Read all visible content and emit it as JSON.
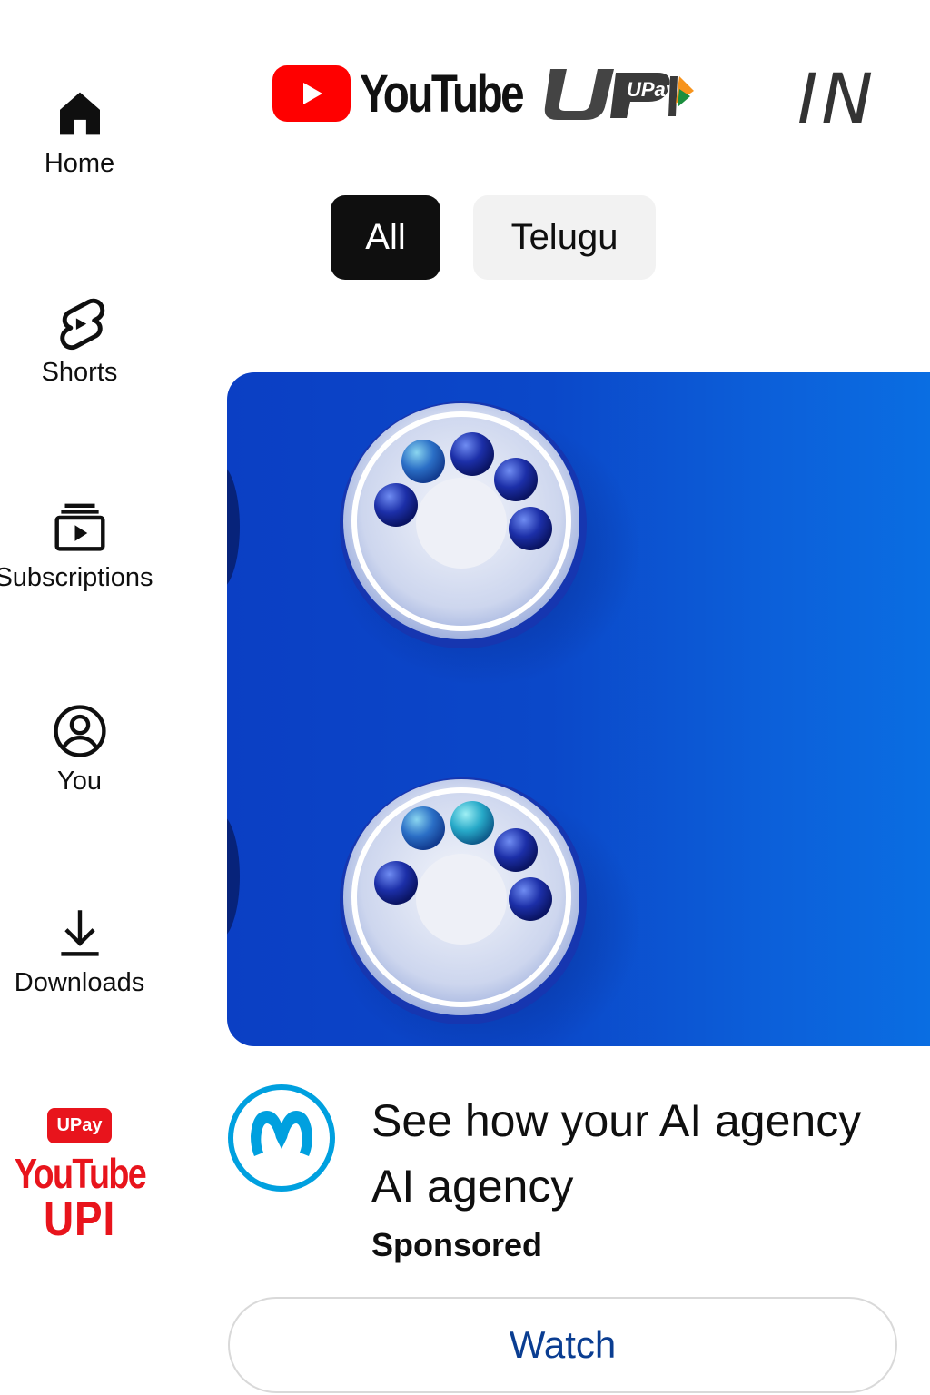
{
  "sidebar": {
    "items": [
      {
        "label": "Home",
        "icon": "home-icon"
      },
      {
        "label": "Shorts",
        "icon": "shorts-icon"
      },
      {
        "label": "Subscriptions",
        "icon": "subscriptions-icon"
      },
      {
        "label": "You",
        "icon": "account-circle-icon"
      },
      {
        "label": "Downloads",
        "icon": "download-icon"
      }
    ],
    "brand": {
      "badge": "UPay",
      "line1": "YouTube",
      "line2": "UPI"
    }
  },
  "header": {
    "logo_text": "YouTube",
    "upi_logo_text": "UPay",
    "country": "IN"
  },
  "chips": [
    {
      "label": "All",
      "selected": true
    },
    {
      "label": "Telugu",
      "selected": false
    }
  ],
  "ad": {
    "title_line1": "See how your AI agency",
    "title_line2": "AI agency",
    "sponsored": "Sponsored",
    "cta": "Watch",
    "channel_icon": "mulesoft-logo-icon"
  },
  "colors": {
    "accent_red": "#e8141c",
    "chip_selected": "#0f0f0f",
    "chip_unselected": "#f2f2f2",
    "thumbnail_blue": "#0b48c9",
    "watch_text": "#0a3d91",
    "channel_logo": "#00a0df"
  }
}
